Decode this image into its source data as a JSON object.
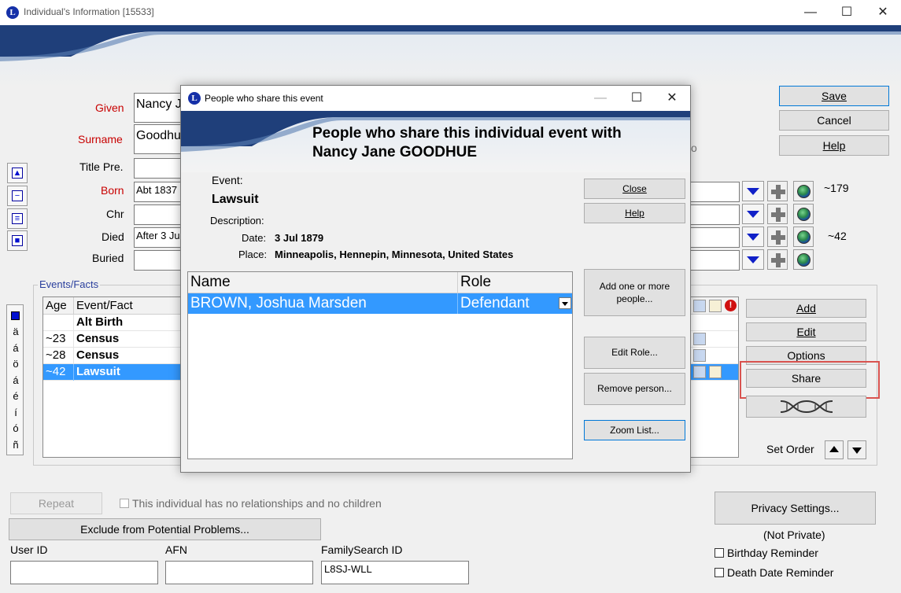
{
  "window": {
    "title": "Individual's Information",
    "record_id": "[15533]",
    "logo_letter": "L",
    "controls": {
      "minimize": "—",
      "maximize": "☐",
      "close": "✕"
    }
  },
  "form": {
    "given_label": "Given",
    "given_value": "Nancy J",
    "surname_label": "Surname",
    "surname_value": "Goodhu",
    "title_pre_label": "Title Pre.",
    "title_pre_value": "",
    "born_label": "Born",
    "born_value": "Abt 1837",
    "chr_label": "Chr",
    "chr_value": "",
    "died_label": "Died",
    "died_value": "After 3 Ju",
    "buried_label": "Buried",
    "buried_value": "",
    "born_age": "~179",
    "died_age": "~42",
    "partial_text_o": "o"
  },
  "buttons": {
    "save": "Save",
    "cancel": "Cancel",
    "help": "Help",
    "add": "Add",
    "edit": "Edit",
    "options": "Options",
    "share": "Share",
    "set_order": "Set Order",
    "repeat": "Repeat",
    "exclude": "Exclude from Potential Problems...",
    "privacy": "Privacy Settings..."
  },
  "nav_buttons": [
    "▲",
    "−",
    "≡",
    "■"
  ],
  "special_chars": [
    "ä",
    "á",
    "ö",
    "á",
    "é",
    "í",
    "ó",
    "ñ"
  ],
  "events": {
    "group_label": "Events/Facts",
    "columns": [
      "Age",
      "Event/Fact"
    ],
    "rows": [
      {
        "age": "",
        "event": "Alt Birth"
      },
      {
        "age": "~23",
        "event": "Census"
      },
      {
        "age": "~28",
        "event": "Census"
      },
      {
        "age": "~42",
        "event": "Lawsuit"
      }
    ]
  },
  "bottom": {
    "no_relationships_text": "This individual has no relationships and no children",
    "user_id_label": "User ID",
    "user_id_value": "",
    "afn_label": "AFN",
    "afn_value": "",
    "familysearch_label": "FamilySearch ID",
    "familysearch_value": "L8SJ-WLL",
    "privacy_status": "(Not Private)",
    "birthday_reminder": "Birthday Reminder",
    "death_reminder": "Death Date Reminder"
  },
  "dialog": {
    "title": "People who share this event",
    "heading_line1": "People who share this individual event with",
    "heading_line2": "Nancy Jane GOODHUE",
    "event_label": "Event:",
    "event_value": "Lawsuit",
    "description_label": "Description:",
    "date_label": "Date:",
    "date_value": "3 Jul 1879",
    "place_label": "Place:",
    "place_value": "Minneapolis, Hennepin, Minnesota, United States",
    "columns": [
      "Name",
      "Role"
    ],
    "people": [
      {
        "name": "BROWN, Joshua Marsden",
        "role": "Defendant"
      }
    ],
    "buttons": {
      "close": "Close",
      "help": "Help",
      "add_people": "Add one or more people...",
      "edit_role": "Edit Role...",
      "remove_person": "Remove person...",
      "zoom_list": "Zoom List..."
    },
    "controls": {
      "minimize": "—",
      "maximize": "☐",
      "close": "✕"
    }
  },
  "colors": {
    "selection": "#3399ff",
    "required_label": "#c80000",
    "highlight_box": "#d9534f",
    "banner_navy": "#1f3f7a"
  }
}
